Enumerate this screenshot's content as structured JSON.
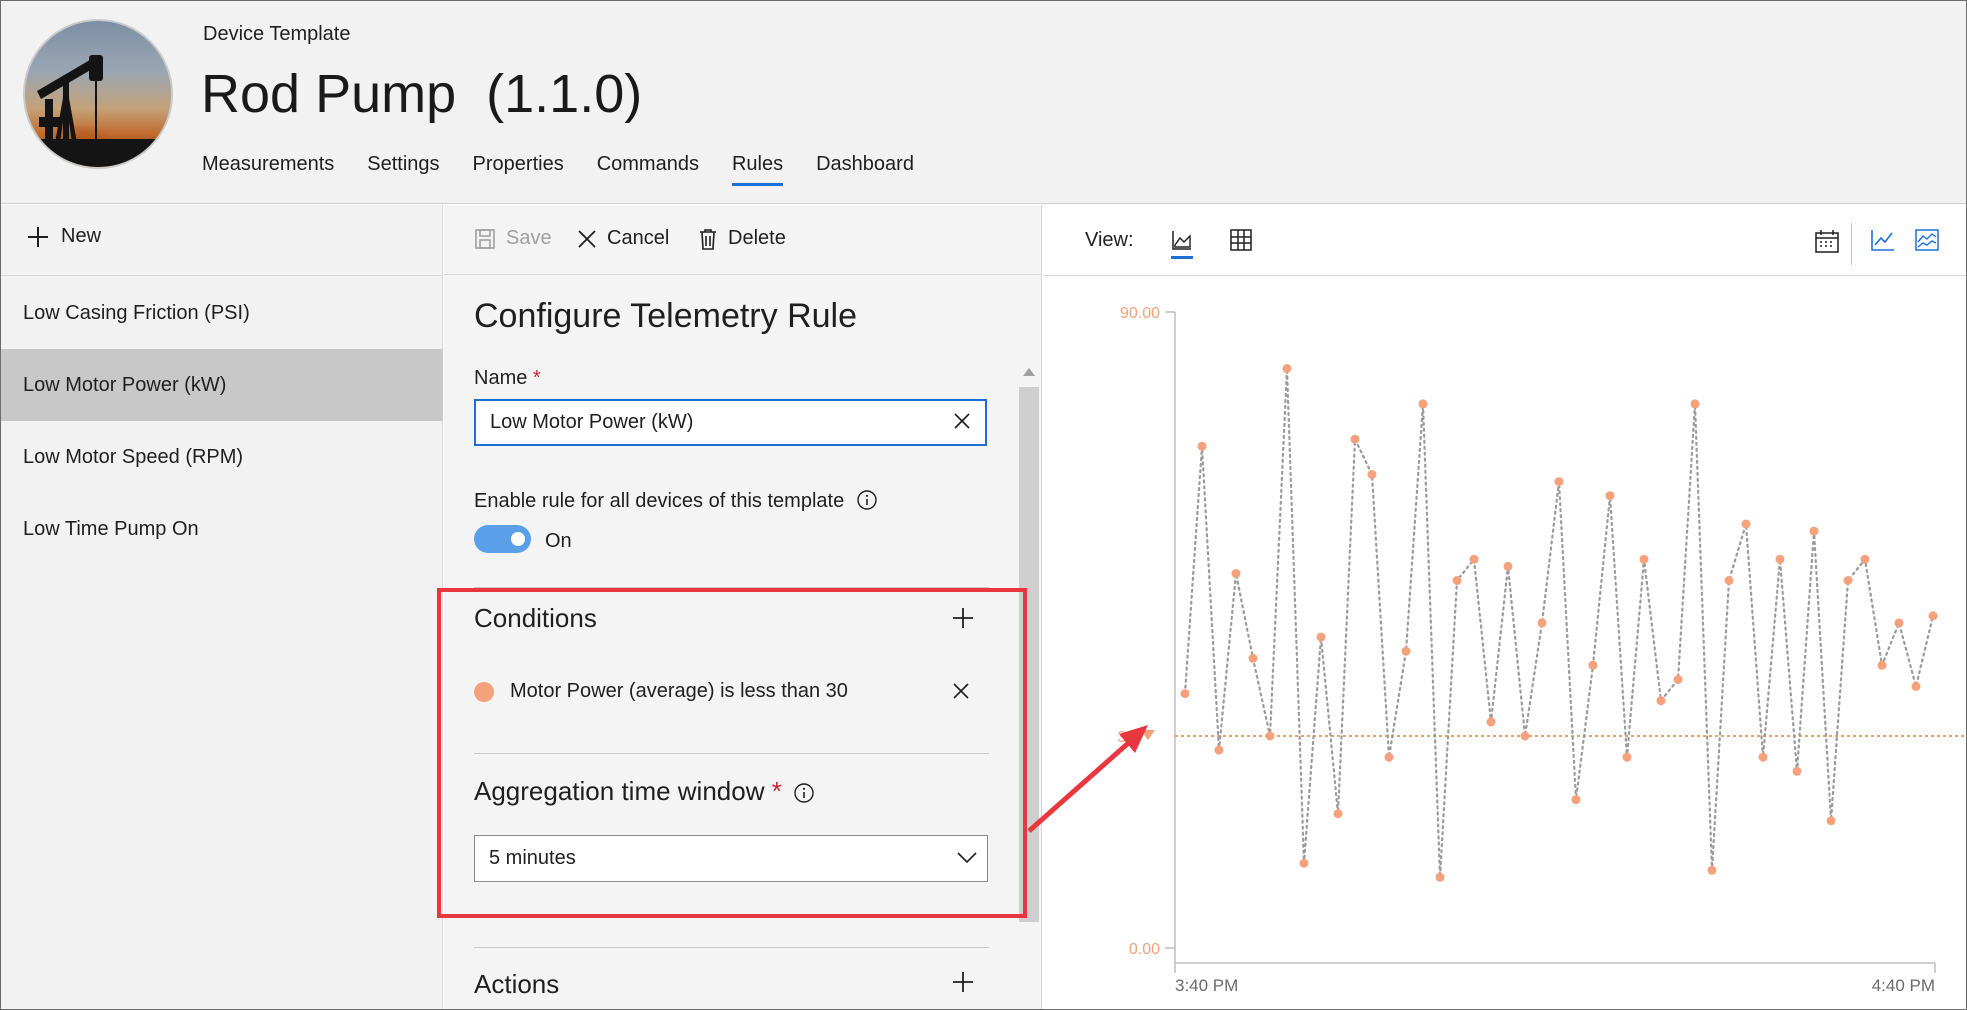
{
  "header": {
    "template_label": "Device Template",
    "title": "Rod Pump",
    "version": "(1.1.0)",
    "tabs": [
      {
        "label": "Measurements"
      },
      {
        "label": "Settings"
      },
      {
        "label": "Properties"
      },
      {
        "label": "Commands"
      },
      {
        "label": "Rules",
        "active": true
      },
      {
        "label": "Dashboard"
      }
    ]
  },
  "sidebar": {
    "new_label": "New",
    "items": [
      {
        "label": "Low Casing Friction (PSI)"
      },
      {
        "label": "Low Motor Power (kW)",
        "selected": true
      },
      {
        "label": "Low Motor Speed (RPM)"
      },
      {
        "label": "Low Time Pump On"
      }
    ]
  },
  "toolbar": {
    "save_label": "Save",
    "cancel_label": "Cancel",
    "delete_label": "Delete"
  },
  "form": {
    "heading": "Configure Telemetry Rule",
    "name_label": "Name",
    "required_mark": "*",
    "name_value": "Low Motor Power (kW)",
    "enable_label": "Enable rule for all devices of this template",
    "toggle_state": "On",
    "conditions_title": "Conditions",
    "condition_text": "Motor Power (average) is less than 30",
    "aggregation_title": "Aggregation time window",
    "aggregation_value": "5 minutes",
    "actions_title": "Actions"
  },
  "view": {
    "label": "View:"
  },
  "colors": {
    "accent": "#1d6fd6",
    "condition": "#f5a27c",
    "highlight": "#e8373f",
    "series_line": "#9a9a9a"
  },
  "chart_data": {
    "type": "line",
    "ylim": [
      0,
      90
    ],
    "y_ticks": [
      "90.00",
      "0.00"
    ],
    "threshold": 30,
    "threshold_label": "30",
    "x_ticks": [
      "3:40 PM",
      "4:40 PM"
    ],
    "series": [
      {
        "values": [
          36,
          71,
          28,
          53,
          41,
          30,
          82,
          12,
          44,
          19,
          72,
          67,
          27,
          42,
          77,
          10,
          52,
          55,
          32,
          54,
          30,
          46,
          66,
          21,
          40,
          64,
          27,
          55,
          35,
          38,
          77,
          11,
          52,
          60,
          27,
          55,
          25,
          59,
          18,
          52,
          55,
          40,
          46,
          37,
          47
        ]
      }
    ]
  }
}
